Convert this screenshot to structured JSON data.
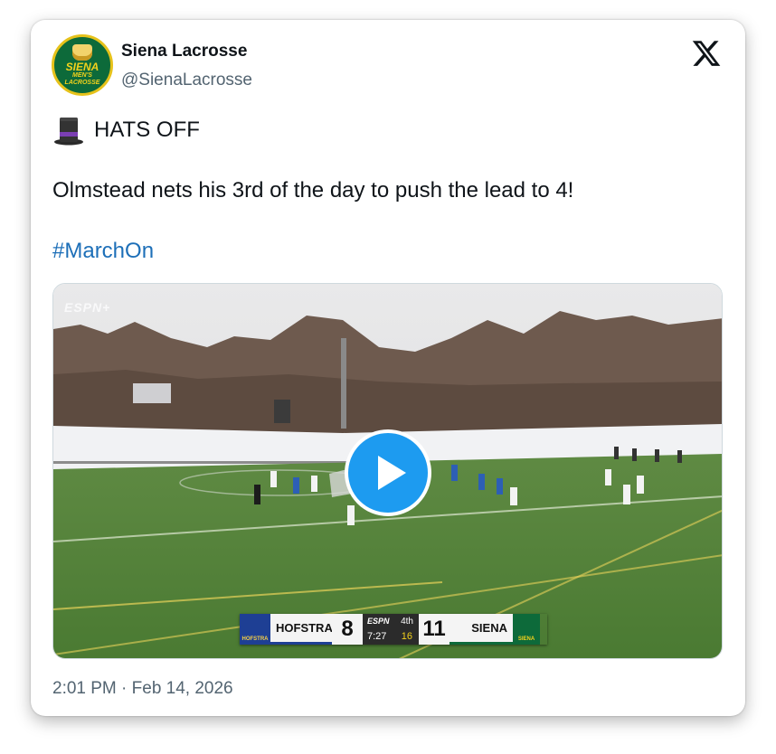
{
  "author": {
    "name": "Siena Lacrosse",
    "handle": "@SienaLacrosse",
    "avatar_text": [
      "SIENA",
      "MEN'S",
      "LACROSSE"
    ]
  },
  "brand_icon": "x-logo-icon",
  "tweet": {
    "emoji_icon": "top-hat-icon",
    "line1": "HATS OFF",
    "line2": "Olmstead nets his 3rd of the day to push the lead to 4!",
    "hashtag": "#MarchOn"
  },
  "video": {
    "watermark": "ESPN+",
    "play_icon": "play-icon",
    "scorebug": {
      "home_logo_text": "HOFSTRA",
      "home_team": "HOFSTRA",
      "home_score": "8",
      "network": "ESPN",
      "period": "4th",
      "clock": "7:27",
      "shot_clock": "16",
      "away_score": "11",
      "away_team": "SIENA",
      "away_logo_text": "SIENA"
    }
  },
  "timestamp": "2:01 PM · Feb 14, 2026",
  "colors": {
    "hashtag": "#1d6fb8",
    "play_button": "#1d9bf0",
    "siena_green": "#0d6a3a",
    "siena_gold": "#f2d11c",
    "hofstra_blue": "#1e3f94"
  }
}
